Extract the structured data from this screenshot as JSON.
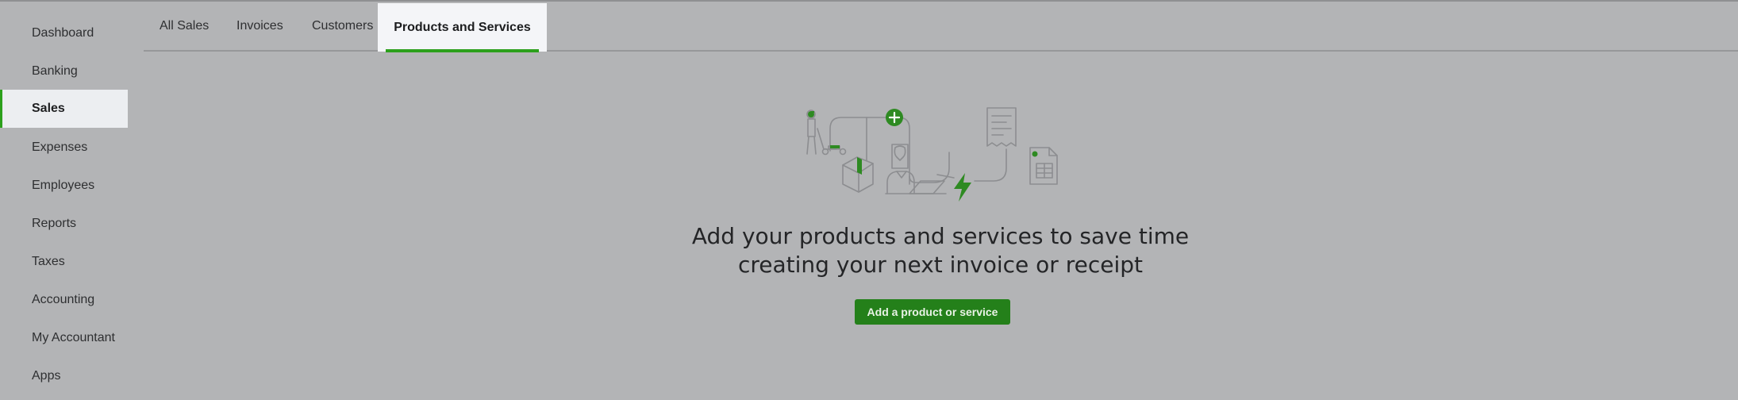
{
  "sidebar": {
    "items": [
      {
        "label": "Dashboard"
      },
      {
        "label": "Banking"
      },
      {
        "label": "Sales",
        "active": true
      },
      {
        "label": "Expenses"
      },
      {
        "label": "Employees"
      },
      {
        "label": "Reports"
      },
      {
        "label": "Taxes"
      },
      {
        "label": "Accounting"
      },
      {
        "label": "My Accountant"
      },
      {
        "label": "Apps"
      }
    ]
  },
  "tabs": [
    {
      "label": "All Sales"
    },
    {
      "label": "Invoices"
    },
    {
      "label": "Customers"
    },
    {
      "label": "Products and Services",
      "active": true
    }
  ],
  "empty_state": {
    "heading_line1": "Add your products and services to save time",
    "heading_line2": "creating your next invoice or receipt",
    "button_label": "Add a product or service"
  },
  "colors": {
    "accent": "#2ca01c",
    "button": "#24801a",
    "overlay_background": "#b3b4b6"
  }
}
